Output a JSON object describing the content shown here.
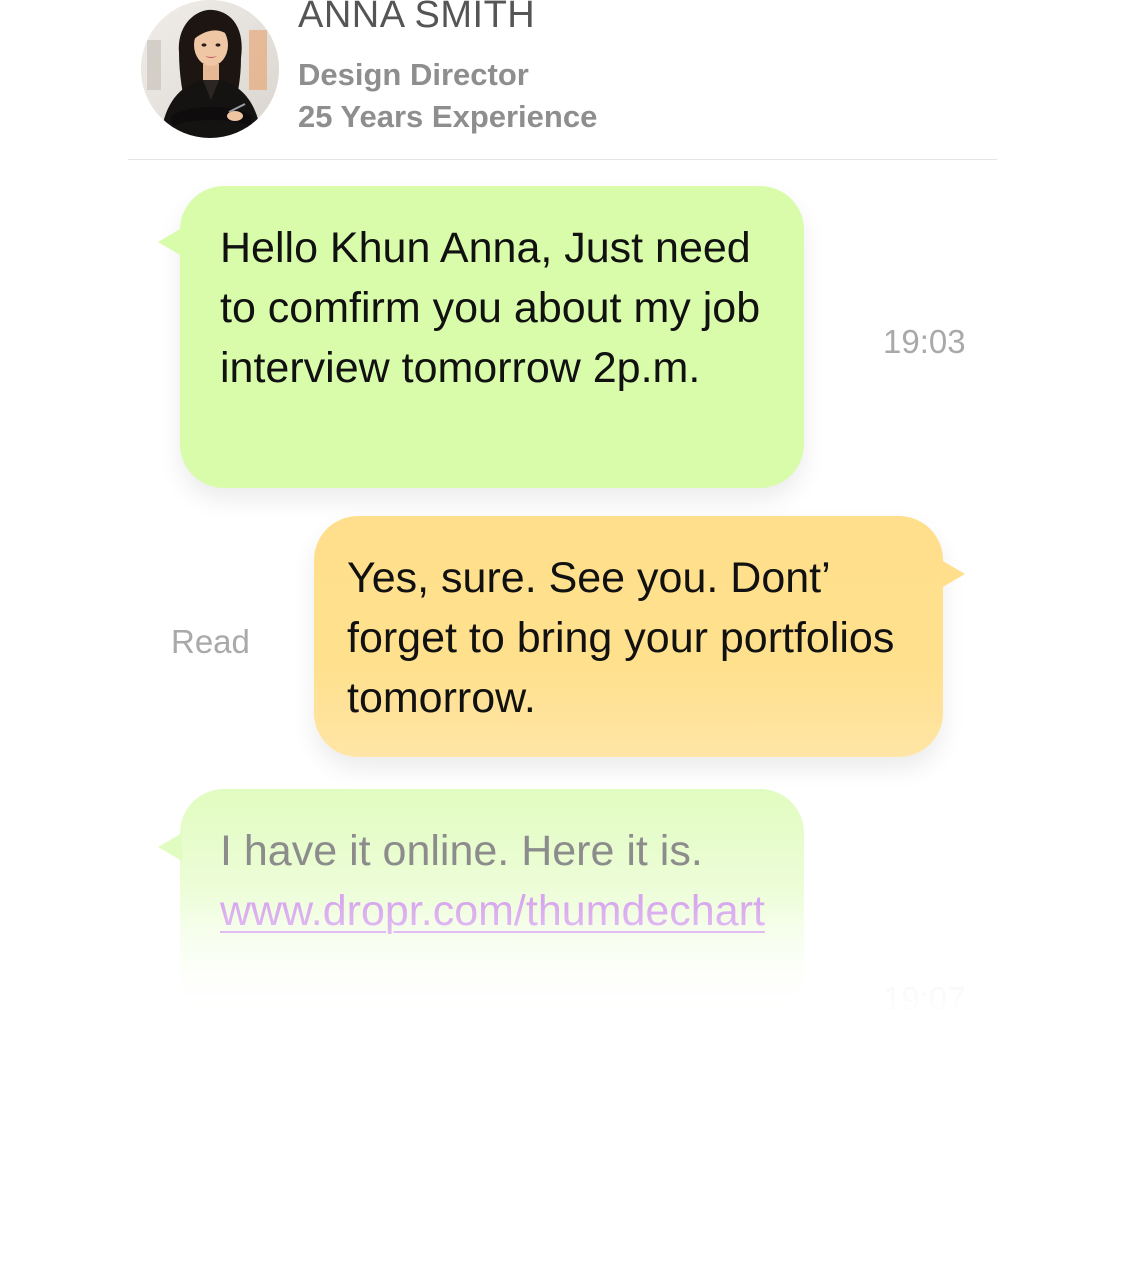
{
  "contact": {
    "name": "ANNA SMITH",
    "role": "Design Director",
    "experience": "25 Years Experience",
    "avatar_icon": "person-portrait-avatar"
  },
  "messages": [
    {
      "direction": "incoming",
      "text": "Hello Khun Anna, Just need to comfirm you about my job interview tomorrow 2p.m.",
      "time": "19:03",
      "bubble_color": "#d8fcaa"
    },
    {
      "direction": "outgoing",
      "text": "Yes, sure. See you. Dont’ forget to bring your portfolios tomorrow.",
      "status": "Read",
      "bubble_color": "#ffdf8c"
    },
    {
      "direction": "incoming",
      "text": "I have it online. Here it is.",
      "link": "www.dropr.com/thumdechart",
      "time": "19:07",
      "bubble_color": "#e1fcc0",
      "link_color": "#d7a6ee"
    }
  ],
  "colors": {
    "name_text": "#555555",
    "subtitle_text": "#8e8e8e",
    "meta_text": "#a9a9a9",
    "divider": "#e4e4e4"
  }
}
